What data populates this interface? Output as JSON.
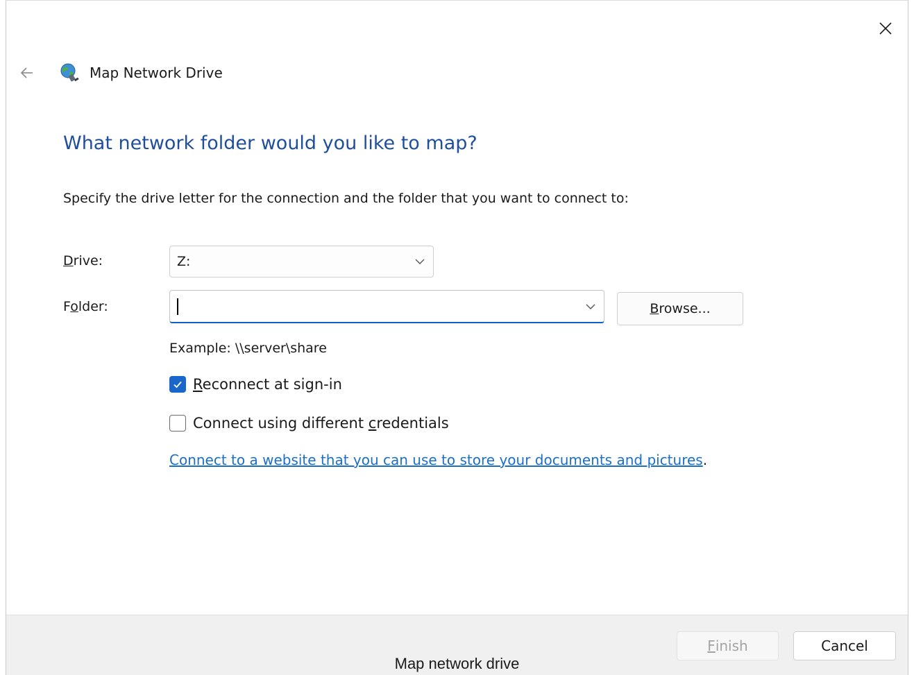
{
  "window": {
    "title": "Map Network Drive",
    "icon": "network-globe-icon"
  },
  "heading": "What network folder would you like to map?",
  "instruction": "Specify the drive letter for the connection and the folder that you want to connect to:",
  "drive": {
    "label_accel": "D",
    "label_rest": "rive:",
    "value": "Z:"
  },
  "folder": {
    "label_pre": "F",
    "label_accel": "o",
    "label_rest": "lder:",
    "value": "",
    "browse_accel": "B",
    "browse_rest": "rowse..."
  },
  "example": "Example: \\\\server\\share",
  "reconnect": {
    "checked": true,
    "label_accel": "R",
    "label_rest": "econnect at sign-in"
  },
  "credentials": {
    "checked": false,
    "label_pre": "Connect using different ",
    "label_accel": "c",
    "label_rest": "redentials"
  },
  "website_link": {
    "text": "Connect to a website that you can use to store your documents and pictures",
    "trailing": "."
  },
  "footer": {
    "finish_accel": "F",
    "finish_rest": "inish",
    "finish_enabled": false,
    "cancel": "Cancel"
  },
  "caption": "Map network drive",
  "colors": {
    "heading": "#1f4e9c",
    "link": "#1b6fc9",
    "accent": "#1b66c9",
    "disabled_text": "#a3a3a3"
  }
}
